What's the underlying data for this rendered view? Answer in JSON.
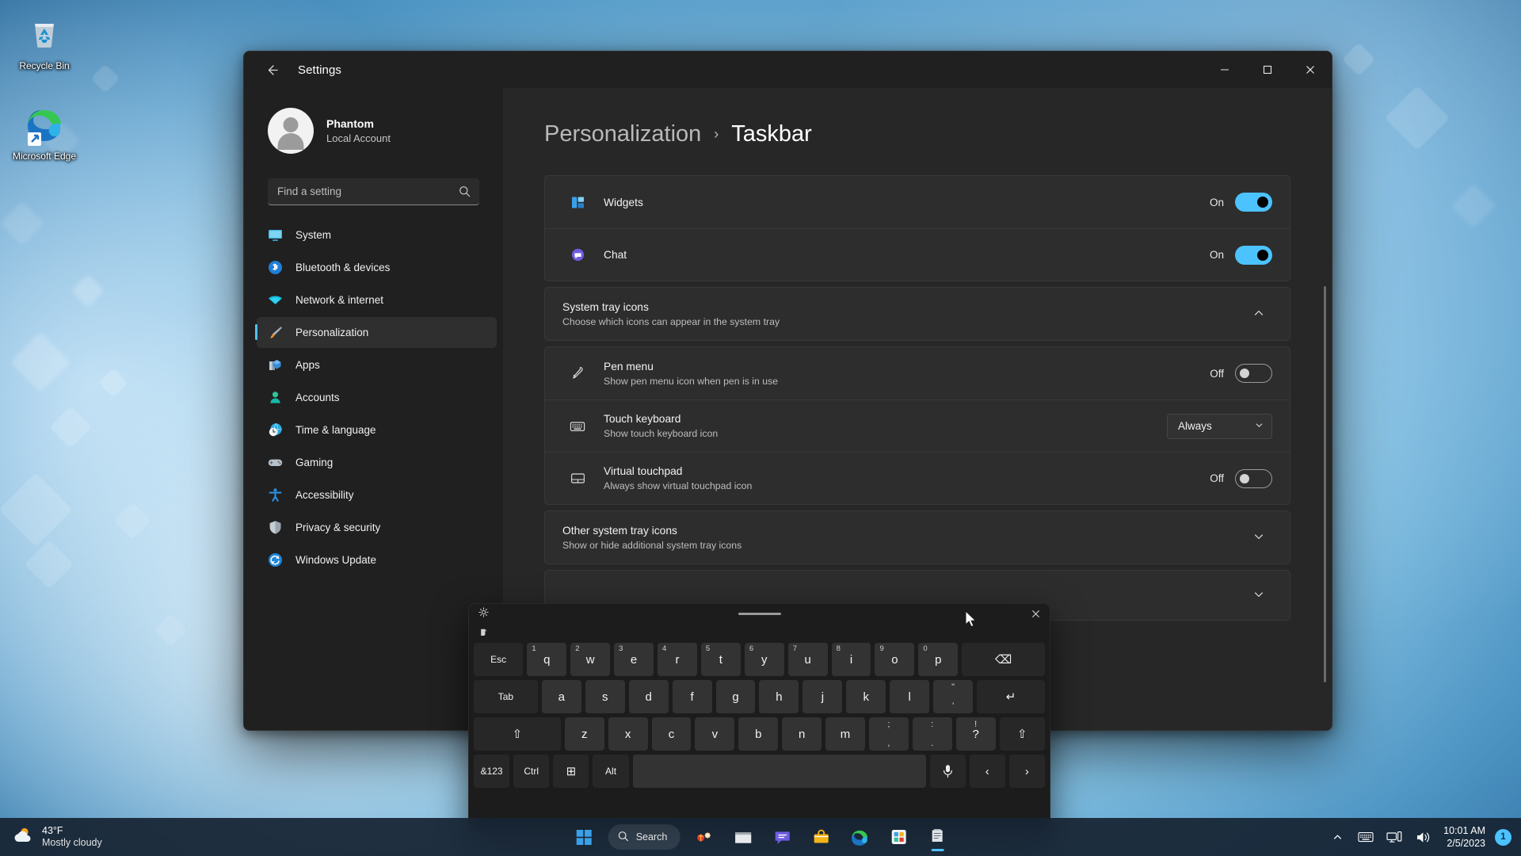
{
  "desktop": {
    "icons": [
      {
        "label": "Recycle Bin",
        "icon": "recycle-bin-icon"
      },
      {
        "label": "Microsoft Edge",
        "icon": "microsoft-edge-icon"
      }
    ]
  },
  "window": {
    "title": "Settings",
    "back_icon": "back-arrow-icon",
    "controls": {
      "minimize": "minimize-icon",
      "maximize": "maximize-icon",
      "close": "close-icon"
    }
  },
  "sidebar": {
    "profile": {
      "name": "Phantom",
      "account_type": "Local Account",
      "avatar": "user-avatar"
    },
    "search": {
      "placeholder": "Find a setting",
      "value": "",
      "icon": "search-icon"
    },
    "items": [
      {
        "label": "System",
        "icon": "system-icon",
        "active": false
      },
      {
        "label": "Bluetooth & devices",
        "icon": "bluetooth-icon",
        "active": false
      },
      {
        "label": "Network & internet",
        "icon": "network-icon",
        "active": false
      },
      {
        "label": "Personalization",
        "icon": "personalization-icon",
        "active": true
      },
      {
        "label": "Apps",
        "icon": "apps-icon",
        "active": false
      },
      {
        "label": "Accounts",
        "icon": "accounts-icon",
        "active": false
      },
      {
        "label": "Time & language",
        "icon": "time-language-icon",
        "active": false
      },
      {
        "label": "Gaming",
        "icon": "gaming-icon",
        "active": false
      },
      {
        "label": "Accessibility",
        "icon": "accessibility-icon",
        "active": false
      },
      {
        "label": "Privacy & security",
        "icon": "privacy-security-icon",
        "active": false
      },
      {
        "label": "Windows Update",
        "icon": "windows-update-icon",
        "active": false
      }
    ]
  },
  "breadcrumb": {
    "parent": "Personalization",
    "separator": "›",
    "current": "Taskbar"
  },
  "main": {
    "taskbar_items": [
      {
        "title": "Widgets",
        "icon": "widgets-icon",
        "state_label": "On",
        "state": "on"
      },
      {
        "title": "Chat",
        "icon": "chat-icon",
        "state_label": "On",
        "state": "on"
      }
    ],
    "system_tray_section": {
      "title": "System tray icons",
      "subtitle": "Choose which icons can appear in the system tray",
      "expanded": true,
      "chevron": "chevron-up-icon",
      "rows": [
        {
          "title": "Pen menu",
          "subtitle": "Show pen menu icon when pen is in use",
          "icon": "pen-icon",
          "control": "toggle",
          "state_label": "Off",
          "state": "off"
        },
        {
          "title": "Touch keyboard",
          "subtitle": "Show touch keyboard icon",
          "icon": "keyboard-icon",
          "control": "dropdown",
          "value": "Always",
          "chevron": "chevron-down-icon"
        },
        {
          "title": "Virtual touchpad",
          "subtitle": "Always show virtual touchpad icon",
          "icon": "touchpad-icon",
          "control": "toggle",
          "state_label": "Off",
          "state": "off"
        }
      ]
    },
    "other_tray_section": {
      "title": "Other system tray icons",
      "subtitle": "Show or hide additional system tray icons",
      "expanded": false,
      "chevron": "chevron-down-icon"
    }
  },
  "keyboard": {
    "gear_icon": "settings-gear-icon",
    "close_icon": "close-icon",
    "clipboard_icon": "clipboard-icon",
    "rows": [
      [
        {
          "label": "Esc",
          "cls": "k-esc dark small"
        },
        {
          "label": "q",
          "sup": "1"
        },
        {
          "label": "w",
          "sup": "2"
        },
        {
          "label": "e",
          "sup": "3"
        },
        {
          "label": "r",
          "sup": "4"
        },
        {
          "label": "t",
          "sup": "5"
        },
        {
          "label": "y",
          "sup": "6"
        },
        {
          "label": "u",
          "sup": "7"
        },
        {
          "label": "i",
          "sup": "8"
        },
        {
          "label": "o",
          "sup": "9"
        },
        {
          "label": "p",
          "sup": "0"
        },
        {
          "label": "⌫",
          "cls": "k-bksp dark"
        }
      ],
      [
        {
          "label": "Tab",
          "cls": "k-tab dark small"
        },
        {
          "label": "a"
        },
        {
          "label": "s"
        },
        {
          "label": "d"
        },
        {
          "label": "f"
        },
        {
          "label": "g"
        },
        {
          "label": "h"
        },
        {
          "label": "j"
        },
        {
          "label": "k"
        },
        {
          "label": "l"
        },
        {
          "label": "",
          "up": "\"",
          "dn": "'"
        },
        {
          "label": "↵",
          "cls": "k-ent dark"
        }
      ],
      [
        {
          "label": "⇧",
          "cls": "k-shl dark"
        },
        {
          "label": "z"
        },
        {
          "label": "x"
        },
        {
          "label": "c"
        },
        {
          "label": "v"
        },
        {
          "label": "b"
        },
        {
          "label": "n"
        },
        {
          "label": "m"
        },
        {
          "label": "",
          "up": ";",
          "dn": ","
        },
        {
          "label": "",
          "up": ":",
          "dn": "."
        },
        {
          "label": "?",
          "up": "!"
        },
        {
          "label": "⇧",
          "cls": "k-shr dark"
        }
      ],
      [
        {
          "label": "&123",
          "cls": "k-123 dark small"
        },
        {
          "label": "Ctrl",
          "cls": "k-ctrl dark small"
        },
        {
          "label": "⊞",
          "cls": "k-win dark"
        },
        {
          "label": "Alt",
          "cls": "k-alt dark small"
        },
        {
          "label": "",
          "cls": "k-space"
        },
        {
          "label": "Ἲ4",
          "cls": "k-mic dark",
          "icon": "microphone-icon"
        },
        {
          "label": "‹",
          "cls": "k-lt dark"
        },
        {
          "label": "›",
          "cls": "k-gt dark"
        }
      ]
    ]
  },
  "taskbar": {
    "weather": {
      "temperature": "43°F",
      "condition": "Mostly cloudy",
      "icon": "partly-cloudy-icon"
    },
    "search": {
      "label": "Search",
      "icon": "search-icon"
    },
    "pinned": [
      {
        "icon": "start-icon",
        "name": "start-button"
      },
      {
        "icon": "widgets-icon",
        "name": "taskbar-widgets"
      },
      {
        "icon": "file-explorer-icon",
        "name": "taskbar-file-explorer"
      },
      {
        "icon": "teams-chat-icon",
        "name": "taskbar-chat"
      },
      {
        "icon": "store-icon",
        "name": "taskbar-store"
      },
      {
        "icon": "edge-icon",
        "name": "taskbar-edge"
      },
      {
        "icon": "settings-icon",
        "name": "taskbar-settings"
      },
      {
        "icon": "touch-keyboard-icon",
        "name": "taskbar-touch-keyboard"
      }
    ],
    "tray": {
      "chevron_icon": "chevron-up-icon",
      "touch_keyboard_icon": "touch-keyboard-icon",
      "network_icon": "network-icon",
      "volume_icon": "volume-icon",
      "time": "10:01 AM",
      "date": "2/5/2023",
      "notification_count": "1"
    }
  },
  "colors": {
    "accent": "#4cc2ff",
    "window_bg": "#202020",
    "card_bg": "#2d2d2d"
  }
}
